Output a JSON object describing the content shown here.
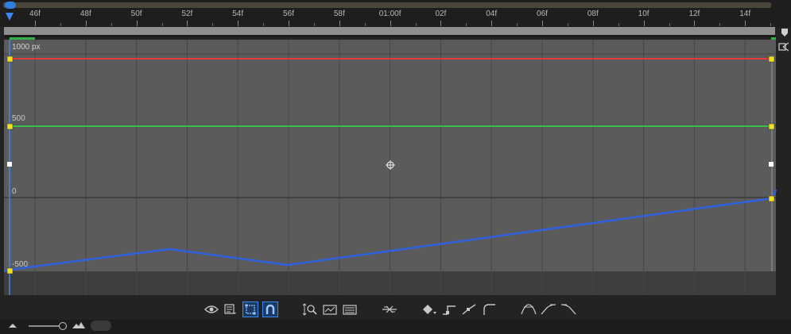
{
  "timeline": {
    "ticks": [
      "46f",
      "48f",
      "50f",
      "52f",
      "54f",
      "56f",
      "58f",
      "01:00f",
      "02f",
      "04f",
      "06f",
      "08f",
      "10f",
      "12f",
      "14f"
    ]
  },
  "graph": {
    "top_label": "1000 px",
    "value_labels": [
      "500",
      "0",
      "-500"
    ],
    "colors": {
      "red_curve": "#e0393e",
      "green_curve": "#38c24a",
      "blue_curve": "#2f62e0",
      "keyframe": "#f0e020",
      "accent": "#3b88f0"
    }
  },
  "toolbar": {
    "icons": [
      "eye-icon",
      "graph-type-menu-icon",
      "transform-box-icon",
      "snap-magnet-icon",
      "fit-selection-icon",
      "fit-all-icon",
      "separate-dimensions-icon",
      "edit-keyframe-icon",
      "hold-keyframe-icon",
      "linear-keyframe-icon",
      "auto-bezier-icon",
      "easy-ease-icon",
      "easy-ease-in-icon",
      "easy-ease-out-icon"
    ]
  }
}
